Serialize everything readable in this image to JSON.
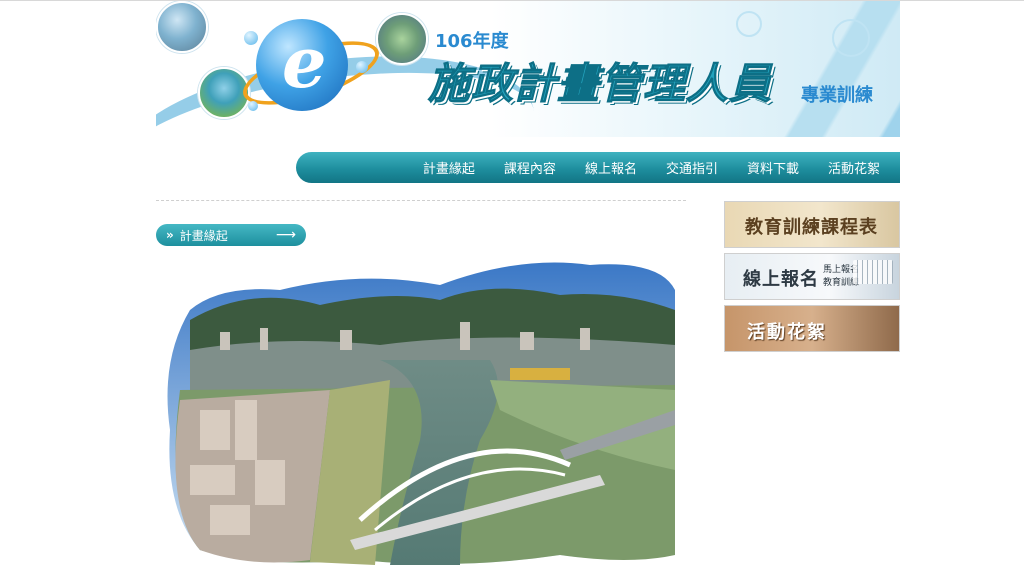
{
  "banner": {
    "year": "106年度",
    "title": "施政計畫管理人員",
    "subtitle": "專業訓練"
  },
  "nav": {
    "items": [
      "計畫緣起",
      "課程內容",
      "線上報名",
      "交通指引",
      "資料下載",
      "活動花絮"
    ]
  },
  "section": {
    "label": "計畫緣起"
  },
  "side_buttons": {
    "schedule": "教育訓練課程表",
    "signup": "線上報名",
    "signup_sub1": "馬上報名",
    "signup_sub2": "教育訓練",
    "gallery": "活動花絮"
  },
  "colors": {
    "nav_teal": "#1e8e9e",
    "title_teal": "#23a3bd",
    "accent_blue": "#2a8ad0"
  }
}
